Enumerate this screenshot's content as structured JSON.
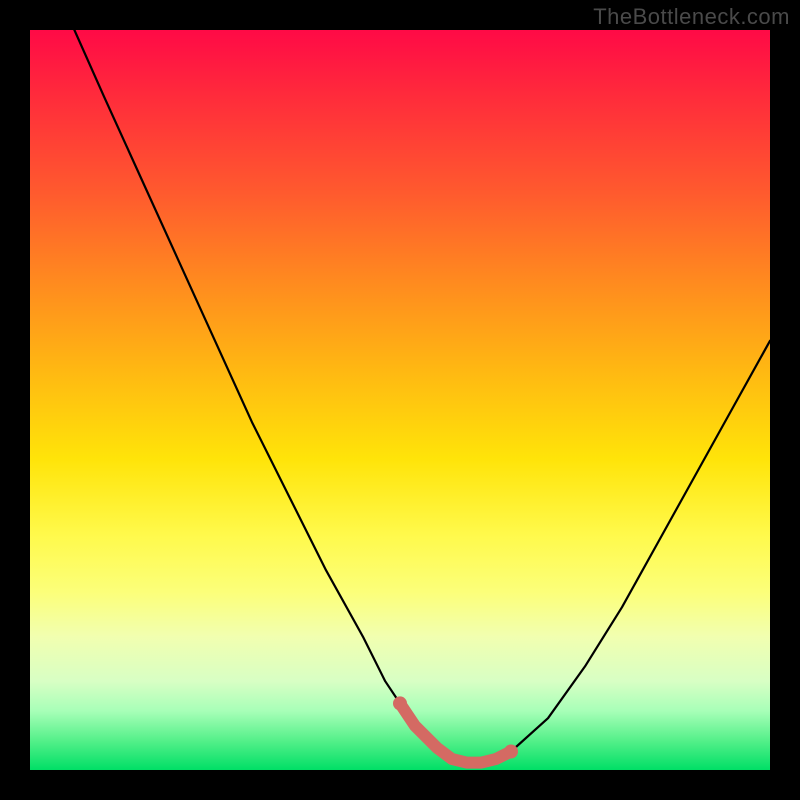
{
  "watermark": "TheBottleneck.com",
  "chart_data": {
    "type": "line",
    "title": "",
    "xlabel": "",
    "ylabel": "",
    "xlim": [
      0,
      100
    ],
    "ylim": [
      0,
      100
    ],
    "series": [
      {
        "name": "bottleneck-curve",
        "x_pct": [
          6,
          10,
          15,
          20,
          25,
          30,
          35,
          40,
          45,
          48,
          50,
          52,
          55,
          57,
          59,
          61,
          63,
          65,
          70,
          75,
          80,
          85,
          90,
          95,
          100
        ],
        "y_pct": [
          0,
          9,
          20,
          31,
          42,
          53,
          63,
          73,
          82,
          88,
          91,
          94,
          97,
          98.5,
          99,
          99,
          98.5,
          97.5,
          93,
          86,
          78,
          69,
          60,
          51,
          42
        ]
      }
    ],
    "highlight_region": {
      "name": "optimal-range",
      "x_pct": [
        50,
        52,
        55,
        57,
        59,
        61,
        63,
        65
      ],
      "y_pct": [
        91,
        94,
        97,
        98.5,
        99,
        99,
        98.5,
        97.5
      ],
      "color": "#d46a63"
    }
  }
}
